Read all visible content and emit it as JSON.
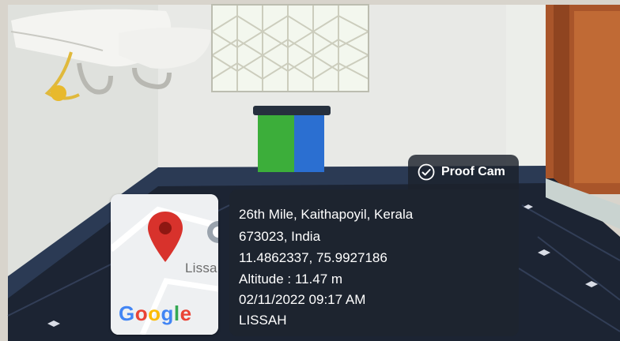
{
  "badge": {
    "label": "Proof Cam",
    "icon": "check-circle-icon"
  },
  "map": {
    "place_label": "Lissa",
    "logo_text": "Google",
    "pin_color": "#d8322c"
  },
  "info": {
    "address_line1": "26th Mile, Kaithapoyil, Kerala",
    "address_line2": "673023, India",
    "coordinates": "11.4862337, 75.9927186",
    "altitude": "Altitude : 11.47 m",
    "datetime": "02/11/2022 09:17 AM",
    "location_name": "LISSAH"
  },
  "colors": {
    "panel_bg": "#1e242e",
    "text": "#ffffff"
  }
}
